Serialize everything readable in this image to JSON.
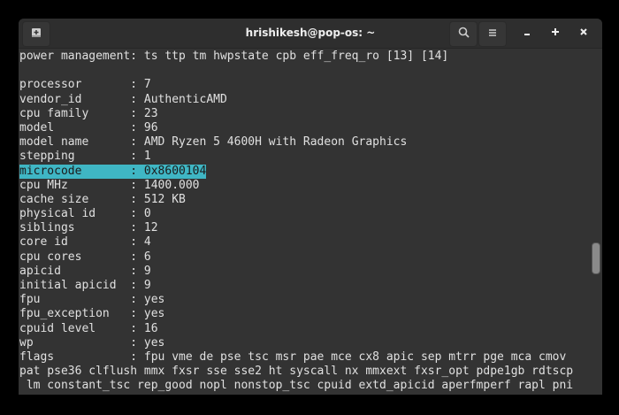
{
  "window": {
    "title": "hrishikesh@pop-os: ~"
  },
  "icons": {
    "new_tab": "new-tab-icon",
    "search": "search-icon",
    "menu": "hamburger-menu-icon",
    "minimize": "minimize-icon",
    "maximize": "maximize-icon",
    "close": "close-icon"
  },
  "highlight_color": "#3fb6c4",
  "terminal": {
    "lines": [
      "power management: ts ttp tm hwpstate cpb eff_freq_ro [13] [14]",
      "",
      "processor\t: 7",
      "vendor_id\t: AuthenticAMD",
      "cpu family\t: 23",
      "model\t\t: 96",
      "model name\t: AMD Ryzen 5 4600H with Radeon Graphics",
      "stepping\t: 1",
      "microcode\t: 0x8600104",
      "cpu MHz\t\t: 1400.000",
      "cache size\t: 512 KB",
      "physical id\t: 0",
      "siblings\t: 12",
      "core id\t\t: 4",
      "cpu cores\t: 6",
      "apicid\t\t: 9",
      "initial apicid\t: 9",
      "fpu\t\t: yes",
      "fpu_exception\t: yes",
      "cpuid level\t: 16",
      "wp\t\t: yes",
      "flags\t\t: fpu vme de pse tsc msr pae mce cx8 apic sep mtrr pge mca cmov",
      "pat pse36 clflush mmx fxsr sse sse2 ht syscall nx mmxext fxsr_opt pdpe1gb rdtscp",
      " lm constant_tsc rep_good nopl nonstop_tsc cpuid extd_apicid aperfmperf rapl pni"
    ],
    "selected_line": 8
  }
}
